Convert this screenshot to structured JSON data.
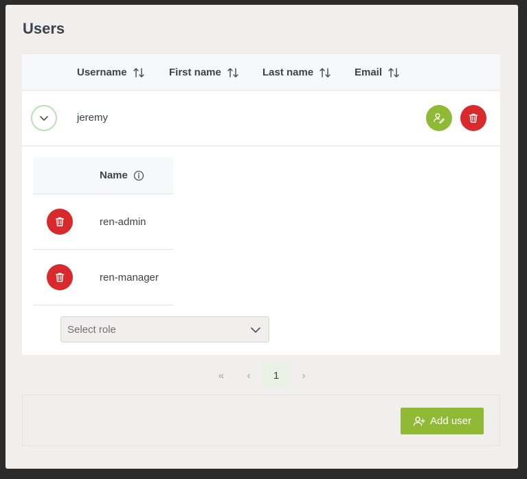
{
  "page": {
    "title": "Users"
  },
  "table": {
    "columns": [
      {
        "label": "Username"
      },
      {
        "label": "First name"
      },
      {
        "label": "Last name"
      },
      {
        "label": "Email"
      }
    ],
    "rows": [
      {
        "username": "jeremy",
        "first_name": "",
        "last_name": "",
        "email": "",
        "expanded": true
      }
    ]
  },
  "roles": {
    "header": "Name",
    "items": [
      {
        "name": "ren-admin"
      },
      {
        "name": "ren-manager"
      }
    ],
    "select_placeholder": "Select role"
  },
  "pagination": {
    "first": "«",
    "prev": "‹",
    "current_page": "1",
    "next": "›"
  },
  "footer": {
    "add_user_label": "Add user"
  },
  "colors": {
    "accent_green": "#90b935",
    "danger_red": "#d8292c"
  },
  "icons": [
    "sort-icon",
    "chevron-down-icon",
    "edit-user-icon",
    "trash-icon",
    "info-icon",
    "add-user-icon"
  ]
}
